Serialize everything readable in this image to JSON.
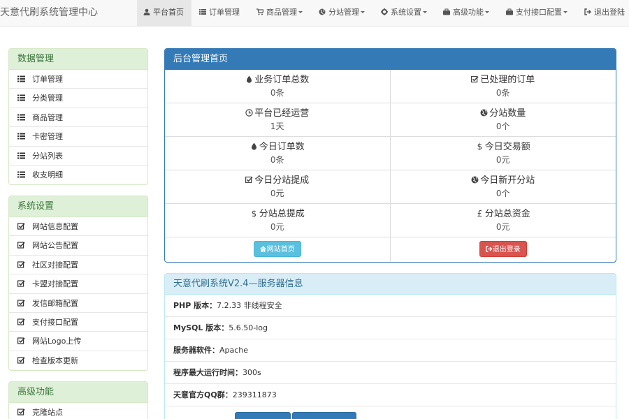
{
  "navbar": {
    "brand": "天意代刷系统管理中心",
    "items": [
      {
        "label": "平台首页",
        "icon": "user-icon",
        "active": true
      },
      {
        "label": "订单管理",
        "icon": "list-icon"
      },
      {
        "label": "商品管理",
        "icon": "cart-icon",
        "dropdown": true
      },
      {
        "label": "分站管理",
        "icon": "globe-icon",
        "dropdown": true
      },
      {
        "label": "系统设置",
        "icon": "gear-icon",
        "dropdown": true
      },
      {
        "label": "高级功能",
        "icon": "briefcase-icon",
        "dropdown": true
      },
      {
        "label": "支付接口配置",
        "icon": "briefcase-icon",
        "dropdown": true
      },
      {
        "label": "退出登陆",
        "icon": "logout-icon"
      }
    ]
  },
  "sidebar": {
    "data_management": {
      "title": "数据管理",
      "items": [
        "订单管理",
        "分类管理",
        "商品管理",
        "卡密管理",
        "分站列表",
        "收支明细"
      ]
    },
    "system_settings": {
      "title": "系统设置",
      "items": [
        "网站信息配置",
        "网站公告配置",
        "社区对接配置",
        "卡盟对接配置",
        "发信邮箱配置",
        "支付接口配置",
        "网站Logo上传",
        "检查版本更新"
      ]
    },
    "advanced": {
      "title": "高级功能",
      "items": [
        "克隆站点"
      ]
    }
  },
  "dashboard": {
    "title": "后台管理首页",
    "stats": [
      {
        "label": "业务订单总数",
        "value": "0条",
        "icon": "tint-icon"
      },
      {
        "label": "已处理的订单",
        "value": "0条",
        "icon": "check-icon"
      },
      {
        "label": "平台已经运营",
        "value": "1天",
        "icon": "clock-icon"
      },
      {
        "label": "分站数量",
        "value": "0个",
        "icon": "globe-icon"
      },
      {
        "label": "今日订单数",
        "value": "0条",
        "icon": "tint-icon"
      },
      {
        "label": "今日交易额",
        "value": "0元",
        "icon": "usd-icon"
      },
      {
        "label": "今日分站提成",
        "value": "0元",
        "icon": "check-icon"
      },
      {
        "label": "今日新开分站",
        "value": "0个",
        "icon": "globe-icon"
      },
      {
        "label": "分站总提成",
        "value": "0元",
        "icon": "usd-icon"
      },
      {
        "label": "分站总资金",
        "value": "0元",
        "icon": "gbp-icon"
      }
    ],
    "home_button": "网站首页",
    "logout_button": "退出登录"
  },
  "server_info": {
    "title": "天意代刷系统V2.4—服务器信息",
    "rows": [
      {
        "label": "PHP 版本：",
        "value": "7.2.33 非线程安全"
      },
      {
        "label": "MySQL 版本：",
        "value": "5.6.50-log"
      },
      {
        "label": "服务器软件：",
        "value": "Apache"
      },
      {
        "label": "程序最大运行时间：",
        "value": "300s"
      },
      {
        "label": "天意官方QQ群：",
        "value": "239311873"
      }
    ]
  },
  "colors": {
    "primary": "#337ab7",
    "success_bg": "#dff0d8",
    "info_bg": "#d9edf7",
    "danger": "#d9534f",
    "btn_info": "#5bc0de"
  }
}
